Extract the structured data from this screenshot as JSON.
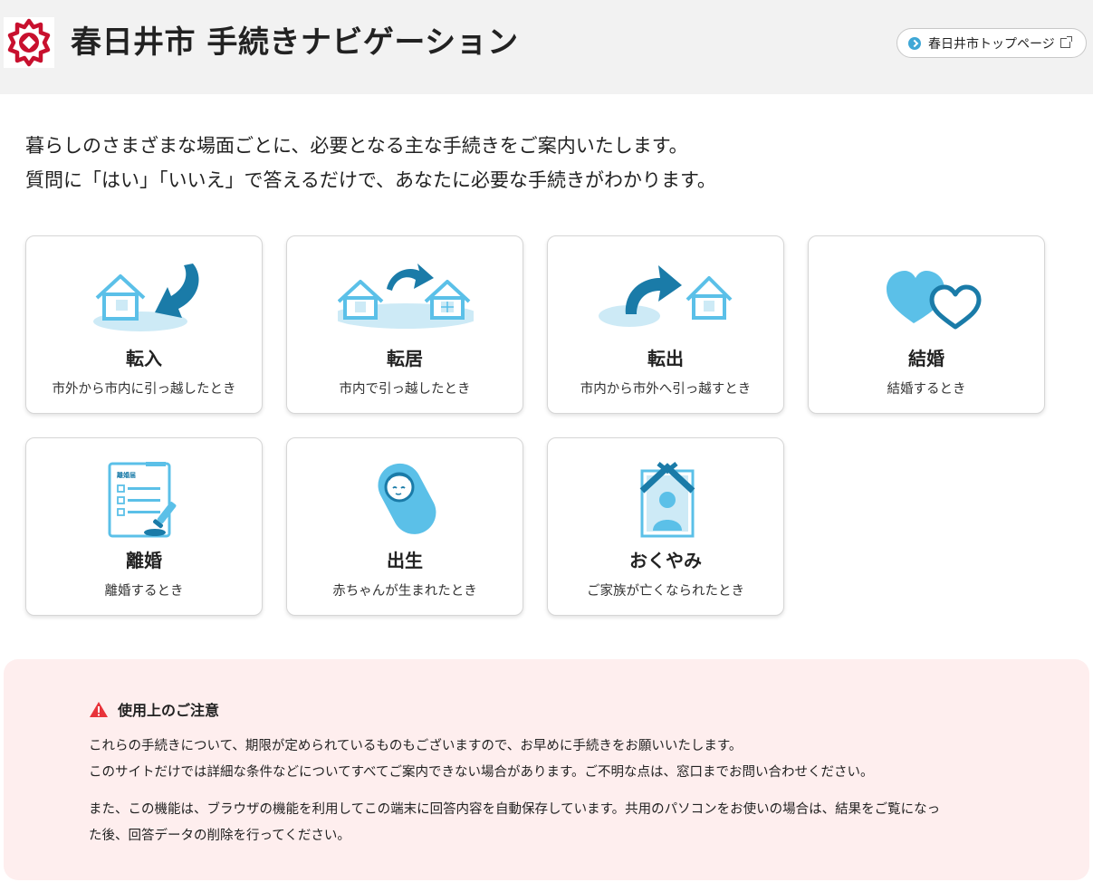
{
  "header": {
    "site_title": "春日井市 手続きナビゲーション",
    "top_link_label": "春日井市トップページ"
  },
  "intro": {
    "line1": "暮らしのさまざまな場面ごとに、必要となる主な手続きをご案内いたします。",
    "line2": "質問に「はい」「いいえ」で答えるだけで、あなたに必要な手続きがわかります。"
  },
  "cards": [
    {
      "title": "転入",
      "subtitle": "市外から市内に引っ越したとき",
      "icon": "move-in-icon"
    },
    {
      "title": "転居",
      "subtitle": "市内で引っ越したとき",
      "icon": "relocation-icon"
    },
    {
      "title": "転出",
      "subtitle": "市内から市外へ引っ越すとき",
      "icon": "move-out-icon"
    },
    {
      "title": "結婚",
      "subtitle": "結婚するとき",
      "icon": "hearts-icon"
    },
    {
      "title": "離婚",
      "subtitle": "離婚するとき",
      "icon": "divorce-form-icon",
      "form_label": "離婚届"
    },
    {
      "title": "出生",
      "subtitle": "赤ちゃんが生まれたとき",
      "icon": "baby-icon"
    },
    {
      "title": "おくやみ",
      "subtitle": "ご家族が亡くなられたとき",
      "icon": "memorial-portrait-icon"
    }
  ],
  "notice": {
    "title": "使用上のご注意",
    "line1": "これらの手続きについて、期限が定められているものもございますので、お早めに手続きをお願いいたします。",
    "line2": "このサイトだけでは詳細な条件などについてすべてご案内できない場合があります。ご不明な点は、窓口までお問い合わせください。",
    "line3": "また、この機能は、ブラウザの機能を利用してこの端末に回答内容を自動保存しています。共用のパソコンをお使いの場合は、結果をご覧になっ",
    "line4": "た後、回答データの削除を行ってください。"
  },
  "colors": {
    "icon_light": "#5bc0e8",
    "icon_dark": "#1a7ba8",
    "ground": "#cdeaf6",
    "logo_red": "#c8102e",
    "warning_red": "#e8333a",
    "notice_bg": "#feeeee",
    "header_bg": "#f2f2f2"
  }
}
